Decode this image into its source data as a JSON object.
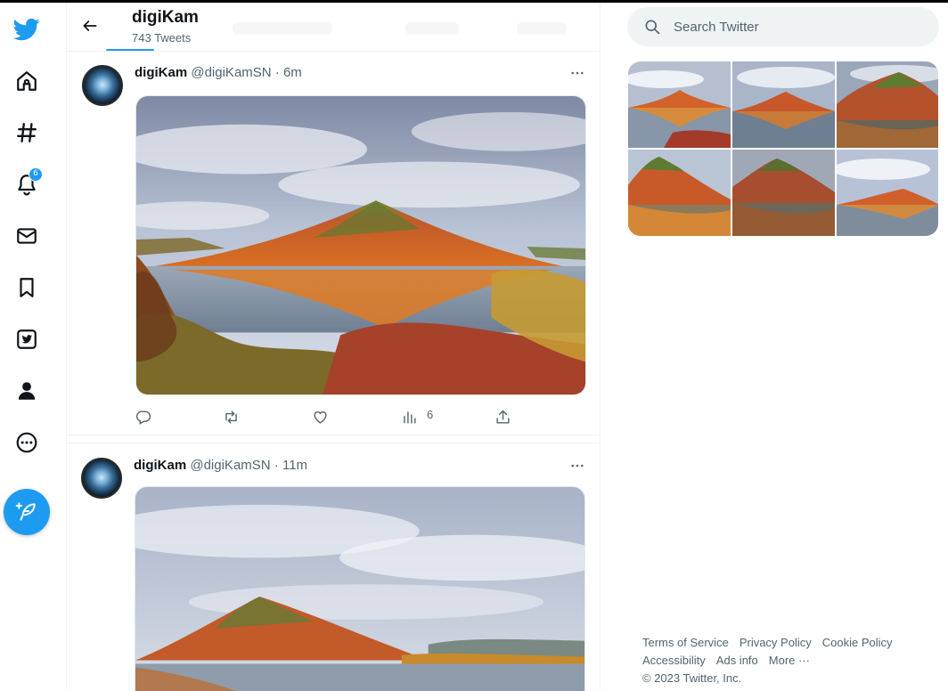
{
  "profile": {
    "name": "digiKam",
    "tweet_count": "743 Tweets"
  },
  "nav": {
    "notifications_badge": "6",
    "items": [
      "twitter-logo",
      "home-icon",
      "explore-hashtag-icon",
      "notifications-bell-icon",
      "messages-envelope-icon",
      "bookmarks-icon",
      "twitter-blue-icon",
      "profile-person-icon",
      "more-circle-icon"
    ],
    "compose_icon": "feather-plus-icon",
    "accent": "#1d9bf0"
  },
  "tweets": [
    {
      "name": "digiKam",
      "handle": "@digiKamSN",
      "separator": "·",
      "time": "6m",
      "media_icon": "photo-red-hill-lake-reflection",
      "stats": {
        "views": "6"
      }
    },
    {
      "name": "digiKam",
      "handle": "@digiKamSN",
      "separator": "·",
      "time": "11m",
      "media_icon": "photo-red-hill-lake-wide"
    }
  ],
  "search": {
    "placeholder": "Search Twitter"
  },
  "media_grid": {
    "count": 6,
    "icon": "photo-thumbnail"
  },
  "footer": {
    "links": [
      "Terms of Service",
      "Privacy Policy",
      "Cookie Policy",
      "Accessibility",
      "Ads info",
      "More ···"
    ],
    "copyright": "© 2023 Twitter, Inc."
  }
}
